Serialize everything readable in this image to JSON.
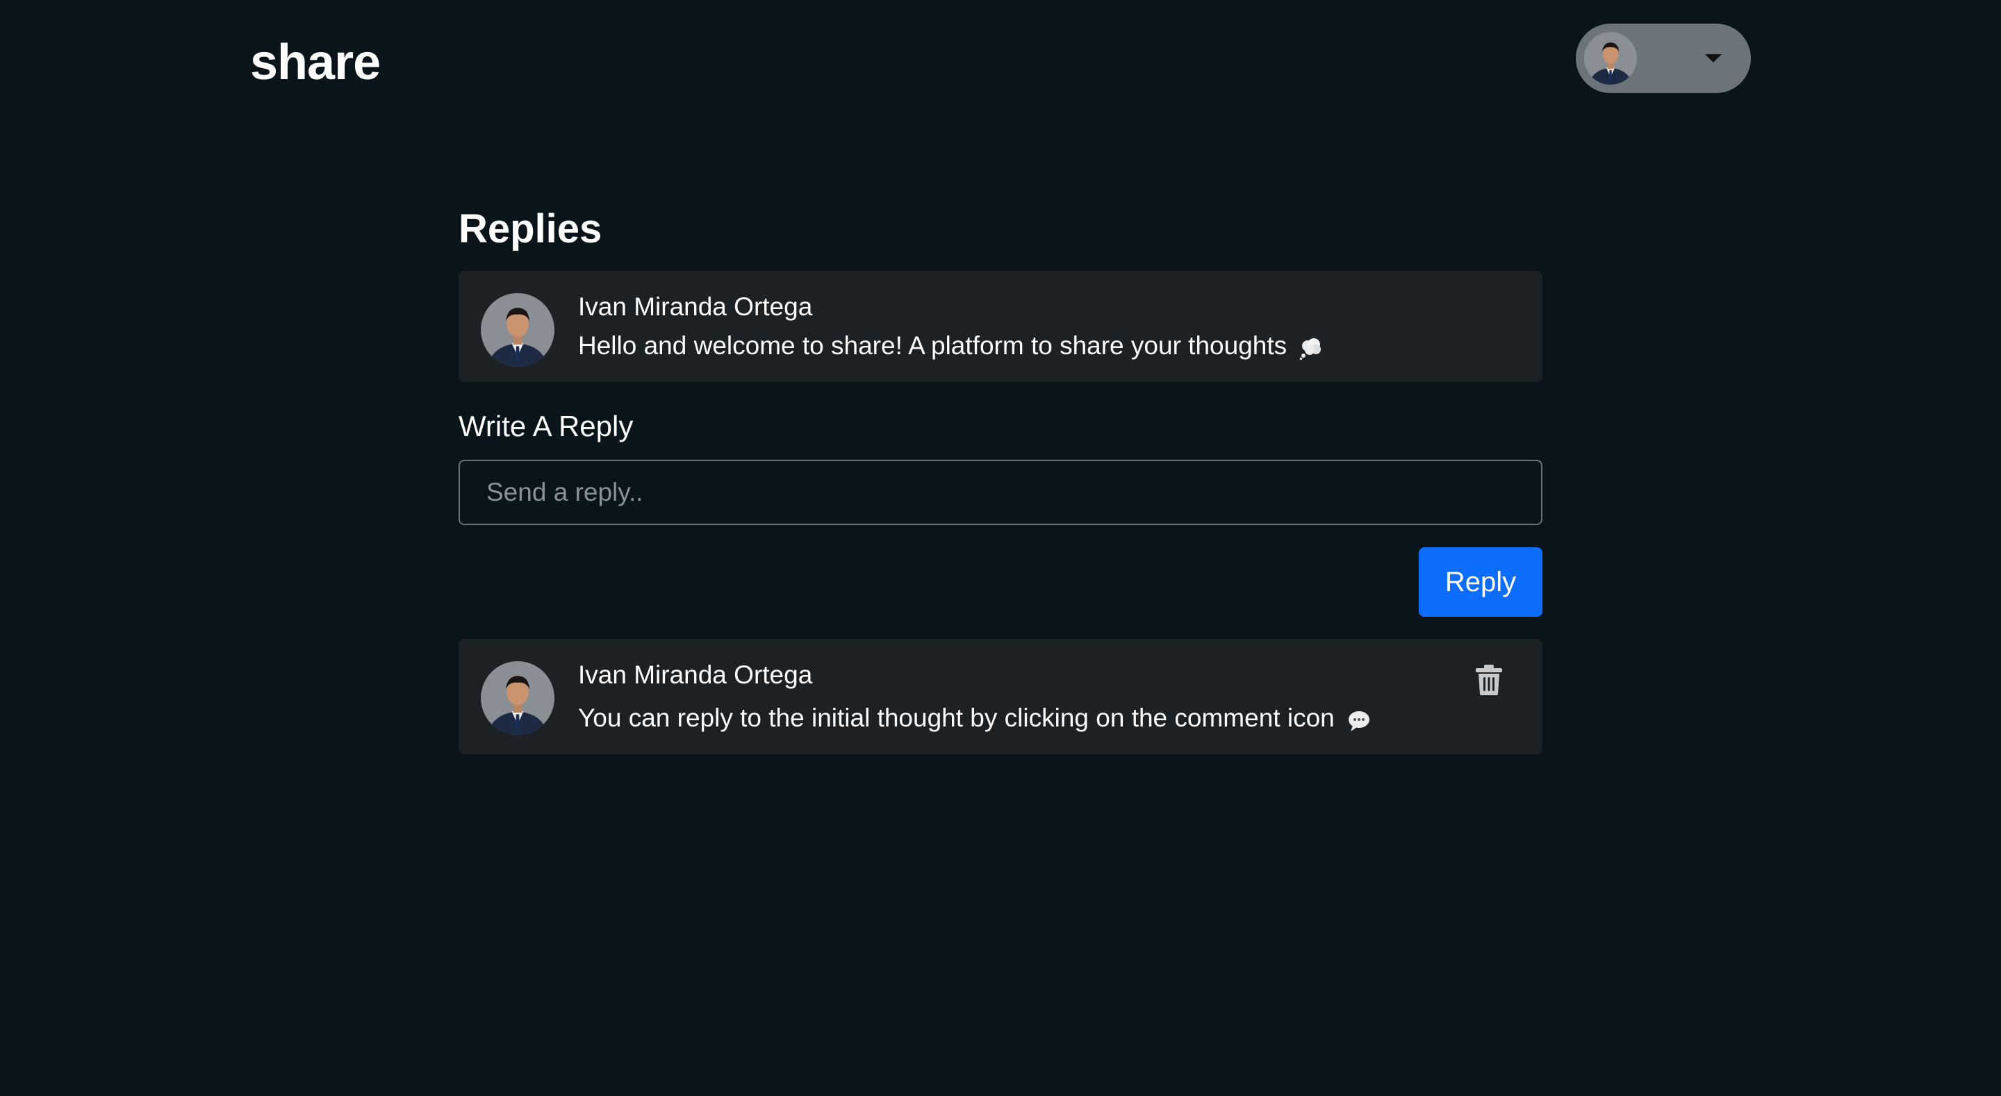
{
  "header": {
    "brand": "share",
    "user_menu": {
      "avatar_icon": "user-avatar",
      "caret_icon": "caret-down-icon"
    }
  },
  "page": {
    "title": "Replies"
  },
  "initial_thought": {
    "author": "Ivan Miranda Ortega",
    "text": "Hello and welcome to share! A platform to share your thoughts",
    "emoji": "thought-balloon"
  },
  "reply_form": {
    "heading": "Write A Reply",
    "placeholder": "Send a reply..",
    "value": "",
    "submit_label": "Reply"
  },
  "replies": [
    {
      "author": "Ivan Miranda Ortega",
      "text": "You can reply to the initial thought by clicking on the comment icon",
      "emoji": "speech-balloon",
      "delete_icon": "trash-icon"
    }
  ],
  "colors": {
    "background": "#09141b",
    "card": "#1c2126",
    "accent": "#0d6efd",
    "user_menu": "#6c737b"
  }
}
